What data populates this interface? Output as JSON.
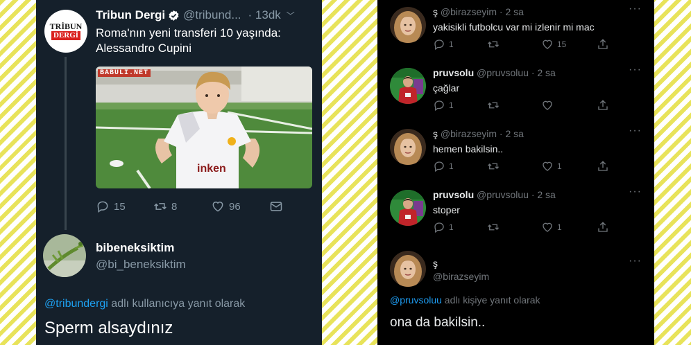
{
  "left": {
    "tweet": {
      "logo_top": "TRİBUN",
      "logo_bottom": "DERGİ",
      "name": "Tribun Dergi",
      "handle": "@tribund...",
      "time": "· 13dk",
      "text": "Roma'nın yeni transferi 10 yaşında: Alessandro Cupini",
      "photo_watermark": "BABULI.NET",
      "replies": "15",
      "retweets": "8",
      "likes": "96"
    },
    "reply": {
      "name": "bibeneksiktim",
      "handle": "@bi_beneksiktim",
      "reply_mention": "@tribundergi",
      "reply_suffix": " adlı kullanıcıya yanıt olarak",
      "text": "Sperm alsaydınız"
    }
  },
  "right": {
    "tweets": [
      {
        "name": "ş",
        "handle": "@birazseyim",
        "time": "· 2 sa",
        "text": "yakisikli futbolcu var mi izlenir mi mac",
        "replies": "1",
        "retweets": "",
        "likes": "15"
      },
      {
        "name": "pruvsolu",
        "handle": "@pruvsoluu",
        "time": "· 2 sa",
        "text": "çağlar",
        "replies": "1",
        "retweets": "",
        "likes": ""
      },
      {
        "name": "ş",
        "handle": "@birazseyim",
        "time": "· 2 sa",
        "text": "hemen bakilsin..",
        "replies": "1",
        "retweets": "",
        "likes": "1"
      },
      {
        "name": "pruvsolu",
        "handle": "@pruvsoluu",
        "time": "· 2 sa",
        "text": "stoper",
        "replies": "1",
        "retweets": "",
        "likes": "1"
      }
    ],
    "last": {
      "name": "ş",
      "handle": "@birazseyim",
      "reply_mention": "@pruvsoluu",
      "reply_suffix": " adlı kişiye yanıt olarak",
      "text": "ona da bakilsin.."
    },
    "more_icon": "···"
  },
  "colors": {
    "left_bg": "#15202b",
    "right_bg": "#000000",
    "mention_blue": "#1da1f2",
    "stripe_yellow": "#e8e35a"
  }
}
